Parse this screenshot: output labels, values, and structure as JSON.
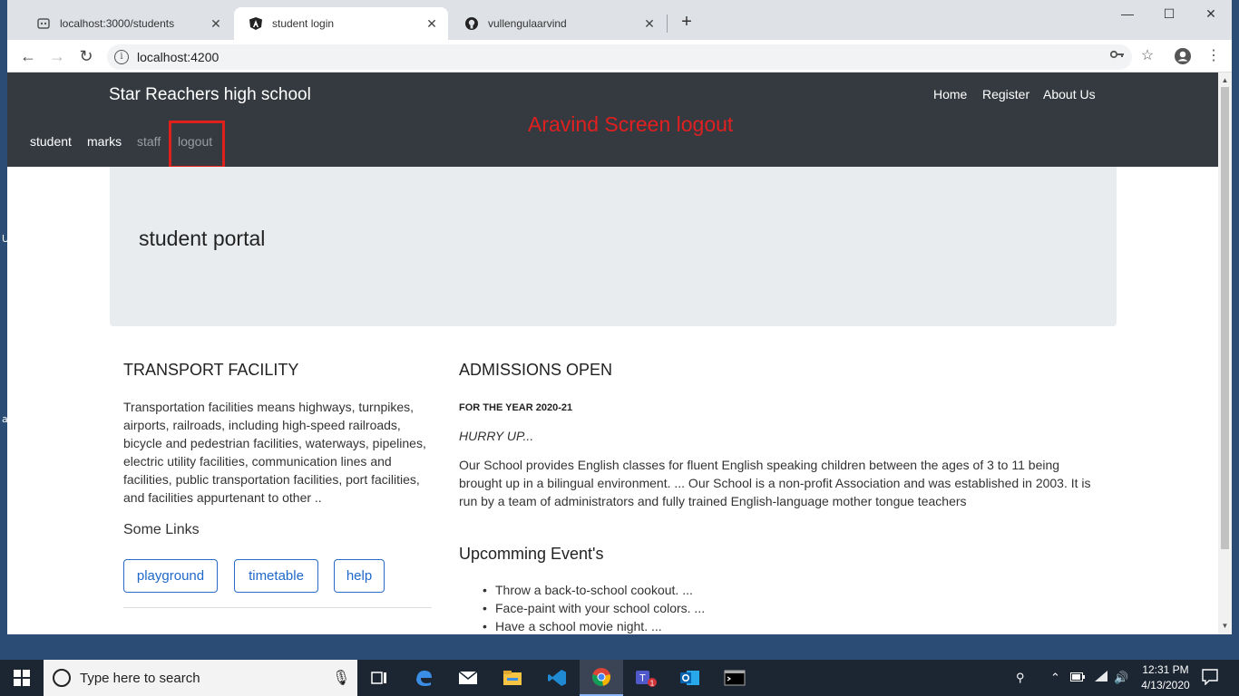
{
  "browser": {
    "tabs": [
      {
        "title": "localhost:3000/students"
      },
      {
        "title": "student login"
      },
      {
        "title": "vullengulaarvind"
      }
    ],
    "url": "localhost:4200"
  },
  "site": {
    "brand": "Star Reachers high school",
    "top_nav": [
      "Home",
      "Register",
      "About Us"
    ],
    "sub_nav": [
      "student",
      "marks",
      "staff",
      "logout"
    ],
    "annotation": "Aravind Screen logout"
  },
  "jumbotron": {
    "title": "student portal"
  },
  "transport": {
    "heading": "TRANSPORT FACILITY",
    "lines": [
      "Transportation facilities means highways, turnpikes,",
      "airports, railroads, including high-speed railroads,",
      "bicycle and pedestrian facilities, waterways, pipelines,",
      "electric utility facilities, communication lines and",
      "facilities, public transportation facilities, port facilities,",
      "and facilities appurtenant to other .."
    ],
    "links_title": "Some Links",
    "links": [
      "playground",
      "timetable",
      "help"
    ]
  },
  "admissions": {
    "heading": "ADMISSIONS OPEN",
    "year": "FOR THE YEAR 2020-21",
    "hurry": "HURRY UP...",
    "lines": [
      "Our School provides English classes for fluent English speaking children between the ages of 3 to 11 being",
      "brought up in a bilingual environment. ... Our School is a non-profit Association and was established in 2003. It is",
      "run by a team of administrators and fully trained English-language mother tongue teachers"
    ]
  },
  "events": {
    "heading": "Upcomming Event's",
    "items": [
      "Throw a back-to-school cookout. ...",
      "Face-paint with your school colors. ...",
      "Have a school movie night. ..."
    ]
  },
  "taskbar": {
    "search_placeholder": "Type here to search",
    "time": "12:31 PM",
    "date": "4/13/2020",
    "teams_badge": "1"
  },
  "colors": {
    "navbar": "#343a40",
    "jumbotron": "#e9ecef",
    "link": "#1f68c8",
    "annotation": "#e02020"
  }
}
